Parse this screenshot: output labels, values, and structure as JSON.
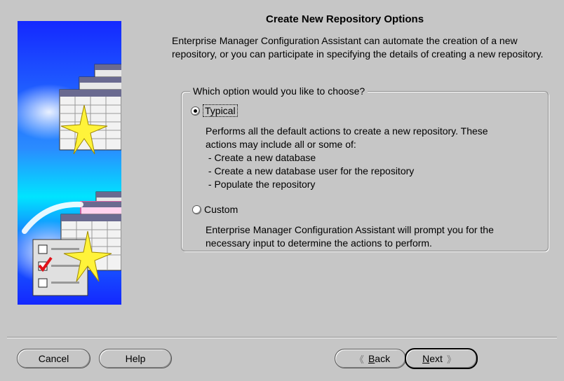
{
  "page": {
    "title": "Create New Repository Options",
    "intro": "Enterprise Manager Configuration Assistant can automate the creation of a new repository, or you can participate in specifying the details of creating a new repository."
  },
  "options_group": {
    "legend": "Which option would you like to choose?",
    "typical": {
      "label": "Typical",
      "selected": true,
      "desc_lines": [
        "Performs all the default actions to create a new repository.  These",
        "actions may include all or some of:",
        " - Create a new database",
        " - Create a new database user for the repository",
        " - Populate the repository"
      ]
    },
    "custom": {
      "label": "Custom",
      "selected": false,
      "desc_lines": [
        "Enterprise Manager Configuration Assistant will prompt you for the",
        "necessary input to determine the actions to perform."
      ]
    }
  },
  "buttons": {
    "cancel": "Cancel",
    "help": "Help",
    "back_mnemonic": "B",
    "back_rest": "ack",
    "next_mnemonic": "N",
    "next_rest": "ext"
  },
  "icons": {
    "back": "chevron-left-icon",
    "next": "chevron-right-icon",
    "art": "database-spark-illustration"
  },
  "colors": {
    "background": "#c6c6c6",
    "art_blue": "#1230ff",
    "art_cyan": "#00e4ff",
    "spark": "#fff33a",
    "check_red": "#e0121a"
  }
}
